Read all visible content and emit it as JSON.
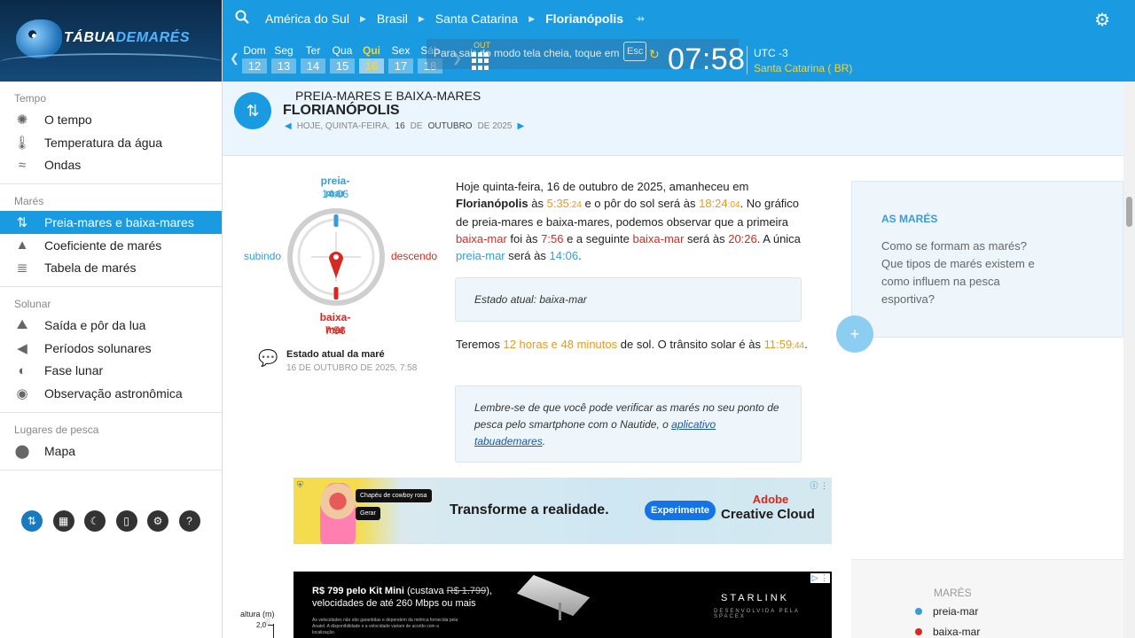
{
  "logo": {
    "part1": "TÁBUA",
    "part2": "DEMARÉS"
  },
  "breadcrumb": [
    "América do Sul",
    "Brasil",
    "Santa Catarina",
    "Florianópolis"
  ],
  "sidebar": {
    "groups": [
      {
        "title": "Tempo",
        "items": [
          {
            "label": "O tempo",
            "icon": "sun-icon"
          },
          {
            "label": "Temperatura da água",
            "icon": "thermometer-icon"
          },
          {
            "label": "Ondas",
            "icon": "wave-icon"
          }
        ]
      },
      {
        "title": "Marés",
        "items": [
          {
            "label": "Preia-mares e baixa-mares",
            "icon": "tide-arrows-icon",
            "active": true
          },
          {
            "label": "Coeficiente de marés",
            "icon": "triangle-icon"
          },
          {
            "label": "Tabela de marés",
            "icon": "table-icon"
          }
        ]
      },
      {
        "title": "Solunar",
        "items": [
          {
            "label": "Saída e pôr da lua",
            "icon": "moon-mountain-icon"
          },
          {
            "label": "Períodos solunares",
            "icon": "fish-icon"
          },
          {
            "label": "Fase lunar",
            "icon": "moon-phase-icon"
          },
          {
            "label": "Observação astronômica",
            "icon": "target-icon"
          }
        ]
      },
      {
        "title": "Lugares de pesca",
        "items": [
          {
            "label": "Mapa",
            "icon": "map-pin-icon"
          }
        ]
      }
    ]
  },
  "days": [
    {
      "name": "Dom",
      "num": "12"
    },
    {
      "name": "Seg",
      "num": "13"
    },
    {
      "name": "Ter",
      "num": "14"
    },
    {
      "name": "Qua",
      "num": "15"
    },
    {
      "name": "Qui",
      "num": "16",
      "today": true
    },
    {
      "name": "Sex",
      "num": "17"
    },
    {
      "name": "Sáb",
      "num": "18"
    }
  ],
  "topbar": {
    "fullscreen_msg": "Para sair do modo tela cheia, toque em",
    "esc_key": "Esc",
    "out_label": "OUT",
    "clock": "07:58",
    "utc": "UTC -3",
    "region": "Santa Catarina ( BR)"
  },
  "header": {
    "subtitle": "PREIA-MARES E BAIXA-MARES",
    "city": "FLORIANÓPOLIS",
    "date_prefix": "HOJE, QUINTA-FEIRA,",
    "date_day": "16",
    "date_de1": "DE",
    "date_month": "OUTUBRO",
    "date_suffix": "DE 2025"
  },
  "dial": {
    "high_label": "preia-mar",
    "high_time": "14:06",
    "low_label": "baixa-mar",
    "low_time": "7:56",
    "rising": "subindo",
    "falling": "descendo"
  },
  "state": {
    "title": "Estado atual da maré",
    "date": "16 DE OUTUBRO DE 2025, 7:58",
    "box": "Estado atual: baixa-mar"
  },
  "summary": {
    "p1": "Hoje quinta-feira, 16 de outubro de 2025, amanheceu em",
    "city": "Florianópolis",
    "p2": "às",
    "sunrise": "5:35",
    "sunrise_s": ":24",
    "p3": "e o pôr do sol será às",
    "sunset": "18:24",
    "sunset_s": ":04",
    "p4": ". No gráfico de preia-mares e baixa-mares, podemos observar que a primeira",
    "low": "baixa-mar",
    "p5": "foi às",
    "low1": "7:56",
    "p6": "e a seguinte",
    "p7": "será às",
    "low2": "20:26",
    "p8": ". A única",
    "high": "preia-mar",
    "p9": "será às",
    "high1": "14:06",
    "p10": "."
  },
  "sun": {
    "p1": "Teremos",
    "daylight": "12 horas e 48 minutos",
    "p2": "de sol. O trânsito solar é às",
    "transit": "11:59",
    "transit_s": ":44",
    "p3": "."
  },
  "app_box": {
    "text": "Lembre-se de que você pode verificar as marés no seu ponto de pesca pelo smartphone com o Nautide, o",
    "link": "aplicativo tabuademares",
    "end": "."
  },
  "ad1": {
    "chip1": "Chapéu de cowboy rosa",
    "chip2": "Gerar",
    "headline": "Transforme a realidade.",
    "cta": "Experimente",
    "brand1": "Adobe",
    "brand2": "Creative Cloud"
  },
  "ad2": {
    "price": "R$ 799 pelo Kit Mini",
    "was_prefix": "(custava",
    "was": "R$ 1.799",
    "was_suffix": "),",
    "l2": "velocidades de até 260 Mbps ou mais",
    "fine": "As velocidades não são garantidas e dependem da métrica fornecida pela Anatel. A disponibilidade e a velocidade variam de acordo com a localização.",
    "brand": "STARLINK",
    "brandsub": "DESENVOLVIDA PELA SPACEX"
  },
  "card1": {
    "title": "AS MARÉS",
    "body": "Como se formam as marés? Que tipos de marés existem e como influem na pesca esportiva?"
  },
  "card2": {
    "title": "MARÉS",
    "legend_high": "preia-mar",
    "legend_low": "baixa-mar"
  },
  "chart": {
    "ylabel": "altura (m)",
    "tick": "2,0"
  },
  "colors": {
    "accent": "#1a9ae0",
    "high": "#3a9bd8",
    "low": "#d52a22",
    "sun": "#e89a19",
    "today": "#f6d33a"
  }
}
